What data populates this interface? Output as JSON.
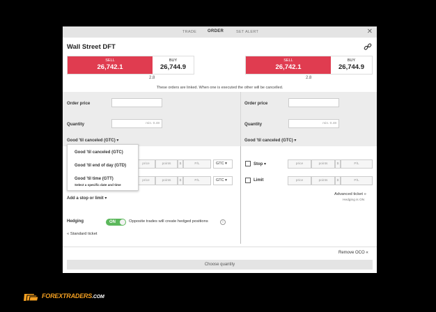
{
  "tabs": [
    "TRADE",
    "ORDER",
    "SET ALERT"
  ],
  "close_icon": "close-icon",
  "instrument": "Wall Street DFT",
  "link_icon": "link-icon",
  "colors": {
    "sell": "#e03c50",
    "toggle_on": "#5cb85c",
    "brand": "#f5a021"
  },
  "left": {
    "sell_label": "SELL",
    "sell_price": "26,742.1",
    "buy_label": "BUY",
    "buy_price": "26,744.9",
    "spread": "2.8",
    "order_price_label": "Order price",
    "quantity_label": "Quantity",
    "quantity_placeholder": "min. 0.48",
    "duration": "Good 'til canceled (GTC) ▾",
    "stop_row": {
      "price": "price",
      "points": "points",
      "currency": "$",
      "pl": "P/L",
      "select": "GTC ▾"
    },
    "limit_row": {
      "price": "price",
      "points": "points",
      "currency": "$",
      "pl": "P/L",
      "select": "GTC ▾"
    },
    "add_stop_limit": "Add a stop or limit ▾",
    "hedging_label": "Hedging",
    "hedging_toggle": "ON",
    "hedging_note": "Opposite trades will create hedged positions",
    "standard_ticket": "Standard ticket"
  },
  "right": {
    "sell_label": "SELL",
    "sell_price": "26,742.1",
    "buy_label": "BUY",
    "buy_price": "26,744.9",
    "spread": "2.8",
    "order_price_label": "Order price",
    "quantity_label": "Quantity",
    "quantity_placeholder": "min. 0.48",
    "duration": "Good 'til canceled (GTC) ▾",
    "stop_label": "Stop ▾",
    "limit_label": "Limit",
    "stop_row": {
      "price": "price",
      "points": "points",
      "currency": "$",
      "pl": "P/L"
    },
    "limit_row": {
      "price": "price",
      "points": "points",
      "currency": "$",
      "pl": "P/L"
    },
    "advanced_ticket": "Advanced ticket",
    "hedging_status": "Hedging is ON"
  },
  "linked_note": "These orders are linked. When one is executed the other will be cancelled.",
  "dropdown": {
    "items": [
      "Good 'til canceled (GTC)",
      "Good 'til end of day (GTD)",
      "Good 'til time (GTT)"
    ],
    "gtt_sub": "Select a specific date and time"
  },
  "remove_oco": "Remove OCO",
  "choose_quantity": "Choose quantity",
  "logo": {
    "main": "FOREXTRADERS",
    "suffix": ".COM"
  }
}
